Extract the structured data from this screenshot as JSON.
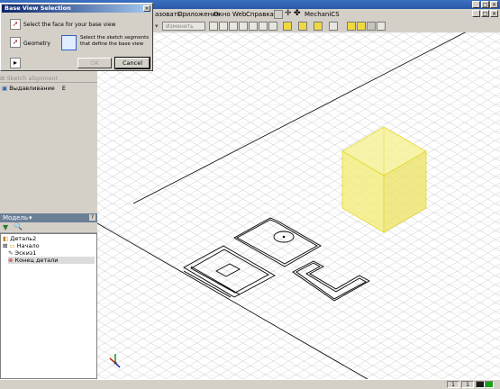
{
  "menubar": {
    "items": [
      "азовать",
      "Приложения",
      "Окно",
      "Web",
      "Справка",
      "MechaniCS"
    ]
  },
  "toolbar": {
    "view_label": "Изменить"
  },
  "dialog": {
    "title": "Base View Selection",
    "close": "×",
    "face_prompt": "Select the face for your base view",
    "geometry_label": "Geometry",
    "segments_prompt": "Select the sketch segments that define the base view",
    "ok_label": "OK",
    "cancel_label": "Cancel"
  },
  "browser": {
    "sketch_alignment": "Sketch alignment",
    "extrude_item": "Выдавливание",
    "extrude_suffix": "E"
  },
  "model_panel": {
    "title": "Модель",
    "tree": {
      "root": "Деталь2",
      "items": [
        "Начало",
        "Эскиз1",
        "Конец детали"
      ]
    }
  },
  "status": {
    "field1": "1",
    "field2": "1"
  },
  "colors": {
    "cube_fill": "#f4f08a",
    "cube_edge": "#e8d820",
    "grid": "#d9d9d9",
    "sketch": "#000000",
    "model_header": "#6b7f96"
  }
}
